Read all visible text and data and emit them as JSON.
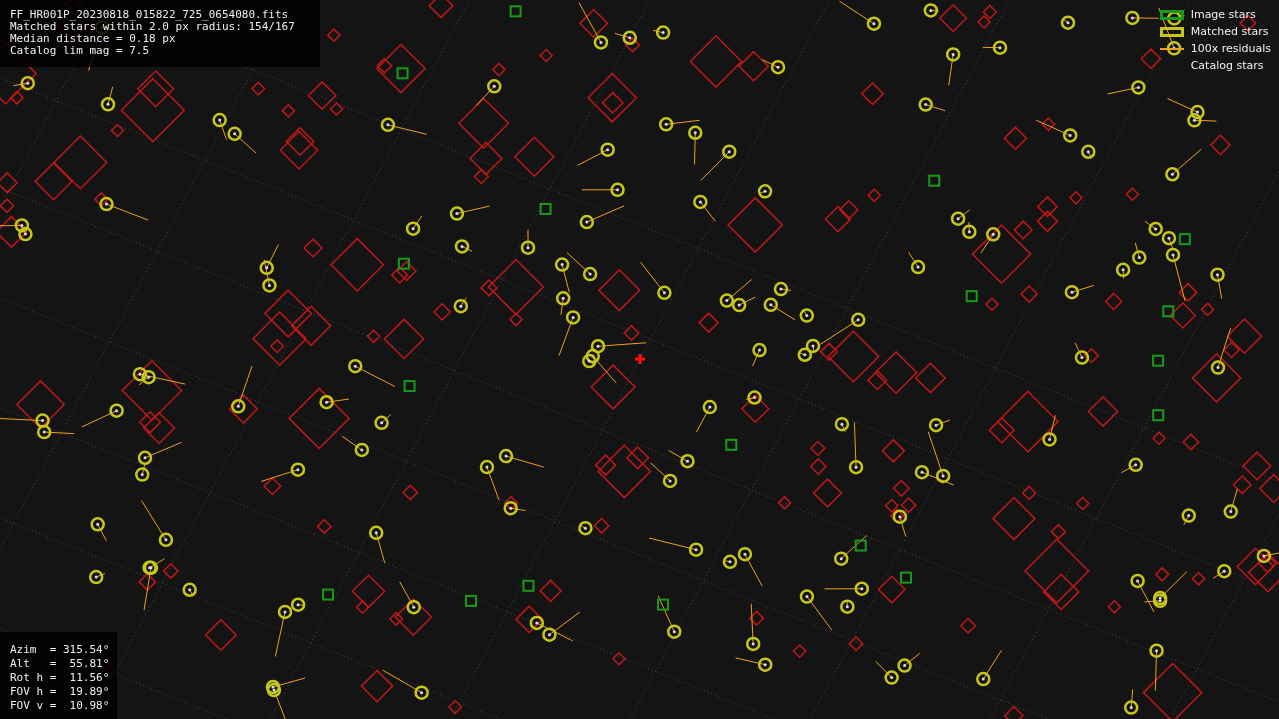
{
  "header": {
    "lines": [
      "FF_HR001P_20230818_015822_725_0654080.fits",
      "Matched stars within 2.0 px radius: 154/167",
      "Median distance = 0.18 px",
      "Catalog lim mag = 7.5"
    ]
  },
  "legend": [
    {
      "label": "Image stars",
      "kind": "box",
      "color": "#1a9a1a"
    },
    {
      "label": "Matched stars",
      "kind": "box",
      "color": "#c8c81a"
    },
    {
      "label": "100x residuals",
      "kind": "line",
      "color": "#f0a020"
    },
    {
      "label": "Catalog stars",
      "kind": "none"
    }
  ],
  "pointing": {
    "lines": [
      "Azim  = 315.54°",
      "Alt   =  55.81°",
      "Rot h =  11.56°",
      "FOV h =  19.89°",
      "FOV v =  10.98°"
    ]
  }
}
